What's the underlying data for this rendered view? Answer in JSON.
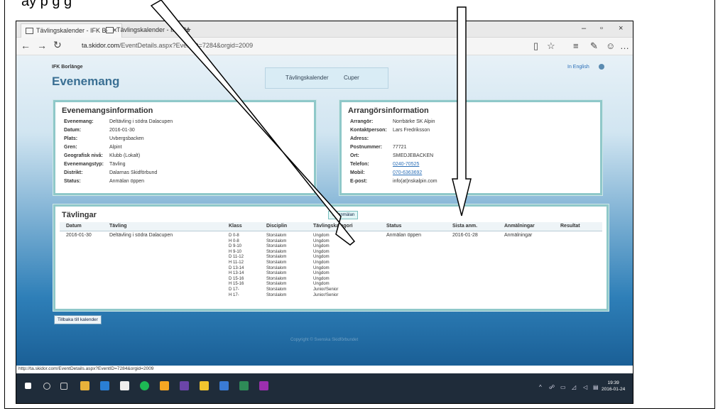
{
  "browser": {
    "tab1_label": "Tävlingskalender - IFK B·",
    "tab2_label": "Tävlingskalender - IFK Bo",
    "url_host": "ta.skidor.com",
    "url_path": "/EventDetails.aspx?EventID=7284&orgid=2009",
    "status_url": "http://ta.skidor.com/EventDetails.aspx?EventID=7284&orgid=2009"
  },
  "page": {
    "org": "IFK Borlänge",
    "title": "Evenemang",
    "nav": [
      "Tävlingskalender",
      "Cuper"
    ],
    "lang_link": "In English",
    "event_panel": {
      "title": "Evenemangsinformation",
      "rows": [
        {
          "k": "Evenemang:",
          "v": "Deltävling i södra Dalacupen"
        },
        {
          "k": "Datum:",
          "v": "2016-01-30"
        },
        {
          "k": "Plats:",
          "v": "Uvbergsbacken"
        },
        {
          "k": "Gren:",
          "v": "Alpint"
        },
        {
          "k": "Geografisk nivå:",
          "v": "Klubb (Lokalt)"
        },
        {
          "k": "Evenemangstyp:",
          "v": "Tävling"
        },
        {
          "k": "Distrikt:",
          "v": "Dalarnas Skidförbund"
        },
        {
          "k": "Status:",
          "v": "Anmälan öppen"
        }
      ]
    },
    "organizer_panel": {
      "title": "Arrangörsinformation",
      "rows": [
        {
          "k": "Arrangör:",
          "v": "Norrbärke SK Alpin"
        },
        {
          "k": "Kontaktperson:",
          "v": "Lars Fredriksson"
        },
        {
          "k": "Adress:",
          "v": ""
        },
        {
          "k": "Postnummer:",
          "v": "77721"
        },
        {
          "k": "Ort:",
          "v": "SMEDJEBACKEN"
        },
        {
          "k": "Telefon:",
          "v": "0240-70525"
        },
        {
          "k": "Mobil:",
          "v": "070-6363692"
        },
        {
          "k": "E-post:",
          "v": "info(at)nskalpin.com"
        }
      ]
    },
    "competitions": {
      "title": "Tävlingar",
      "register_button": "Till anmälan",
      "columns": [
        "Datum",
        "Tävling",
        "Klass",
        "Disciplin",
        "Tävlingskategori",
        "Status",
        "Sista anm.",
        "Anmälningar",
        "Resultat"
      ],
      "row": {
        "datum": "2016-01-30",
        "tavling": "Deltävling i södra Dalacupen",
        "klasser": [
          "D 0-8",
          "H 0-8",
          "D 9-10",
          "H 9-10",
          "D 11-12",
          "H 11-12",
          "D 13-14",
          "H 13-14",
          "D 15-16",
          "H 15-16",
          "D 17-",
          "H 17-"
        ],
        "discipliner": [
          "Storslalom",
          "Storslalom",
          "Storslalom",
          "Storslalom",
          "Storslalom",
          "Storslalom",
          "Storslalom",
          "Storslalom",
          "Storslalom",
          "Storslalom",
          "Storslalom",
          "Storslalom"
        ],
        "kategorier": [
          "Ungdom",
          "Ungdom",
          "Ungdom",
          "Ungdom",
          "Ungdom",
          "Ungdom",
          "Ungdom",
          "Ungdom",
          "Ungdom",
          "Ungdom",
          "Junior/Senior",
          "Junior/Senior"
        ],
        "status": "Anmälan öppen",
        "sista_anm": "2016-01-28",
        "anmalningar": "Anmälningar",
        "resultat": ""
      }
    },
    "back_button": "Tillbaka till kalender",
    "copyright": "Copyright © Svenska Skidförbundet"
  },
  "taskbar": {
    "time": "19:39",
    "date": "2016-01-24"
  },
  "annotation": {
    "caption": "ay          p                                                                  g  g"
  },
  "colors": {
    "accent": "#3a6f93",
    "panel_border": "#8fc8c9",
    "link": "#2b6fb7"
  }
}
